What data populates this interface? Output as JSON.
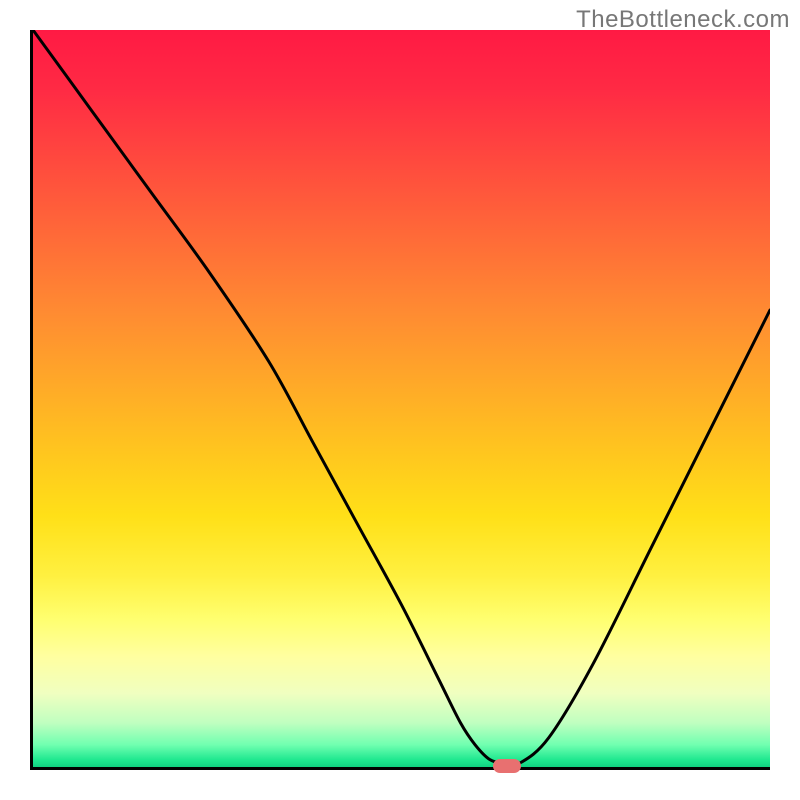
{
  "watermark": "TheBottleneck.com",
  "chart_data": {
    "type": "line",
    "title": "",
    "xlabel": "",
    "ylabel": "",
    "xlim": [
      0,
      100
    ],
    "ylim": [
      0,
      100
    ],
    "series": [
      {
        "name": "curve",
        "x": [
          0,
          8,
          16,
          24,
          32,
          38,
          44,
          50,
          55,
          58,
          60,
          62,
          64,
          66,
          70,
          76,
          84,
          92,
          100
        ],
        "y": [
          100,
          89,
          78,
          67,
          55,
          44,
          33,
          22,
          12,
          6,
          3,
          1,
          0.5,
          0.5,
          4,
          14,
          30,
          46,
          62
        ]
      }
    ],
    "marker": {
      "x": 64,
      "y": 0.5
    },
    "gradient": {
      "top_color": "#ff1a44",
      "mid_color": "#ffd020",
      "bottom_color": "#10d080"
    }
  }
}
